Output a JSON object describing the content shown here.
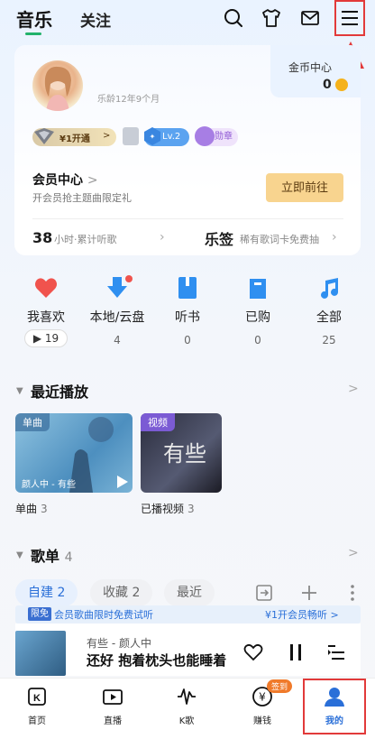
{
  "header": {
    "tabs": [
      {
        "label": "音乐",
        "active": true
      },
      {
        "label": "关注",
        "active": false
      }
    ],
    "icons": [
      "search-icon",
      "tshirt-icon",
      "mail-icon",
      "menu-icon"
    ]
  },
  "profile": {
    "level_age": "乐龄12年9个月",
    "coin_title": "金币中心",
    "coin_value": "0",
    "vip_label": "¥1开通",
    "vip_arrow": ">",
    "lv_label": "Lv.2",
    "medal_label": "勋章",
    "member_title": "会员中心",
    "member_chev": ">",
    "member_sub": "开会员抢主题曲限定礼",
    "goto_button": "立即前往",
    "hours_value": "38",
    "hours_label": "小时·累计听歌",
    "lyric_title": "乐签",
    "lyric_sub": "稀有歌词卡免费抽"
  },
  "quick_entries": [
    {
      "label": "我喜欢",
      "count": "▶ 19",
      "icon": "heart-icon"
    },
    {
      "label": "本地/云盘",
      "count": "4",
      "icon": "download-icon"
    },
    {
      "label": "听书",
      "count": "0",
      "icon": "book-icon"
    },
    {
      "label": "已购",
      "count": "0",
      "icon": "bag-icon"
    },
    {
      "label": "全部",
      "count": "25",
      "icon": "music-note-icon"
    }
  ],
  "recent": {
    "title": "最近播放",
    "caret": "▼",
    "chev": ">",
    "tiles": [
      {
        "tag": "单曲",
        "caption": "颜人中 - 有些",
        "label": "单曲",
        "count": "3"
      },
      {
        "tag": "视频",
        "caption": "",
        "video_text": "有些",
        "label": "已播视频",
        "count": "3"
      }
    ]
  },
  "playlists": {
    "title": "歌单",
    "count": "4",
    "tabs": [
      {
        "label": "自建 2",
        "active": true
      },
      {
        "label": "收藏 2",
        "active": false
      },
      {
        "label": "最近",
        "active": false
      }
    ]
  },
  "mini_player": {
    "promo_tag": "限免",
    "promo_text": "会员歌曲限时免费试听",
    "promo_right": "¥1开会员畅听 >",
    "song": "有些",
    "separator": "-",
    "artist": "颜人中",
    "lyric": "还好 抱着枕头也能睡着"
  },
  "bottom_nav": [
    {
      "label": "首页",
      "icon": "k-home-icon"
    },
    {
      "label": "直播",
      "icon": "live-tv-icon"
    },
    {
      "label": "K歌",
      "icon": "waveform-icon"
    },
    {
      "label": "赚钱",
      "icon": "yen-coin-icon",
      "badge": "签到"
    },
    {
      "label": "我的",
      "icon": "person-icon",
      "active": true
    }
  ],
  "colors": {
    "accent_green": "#22b26b",
    "accent_blue": "#2a6fd8",
    "highlight_red": "#e23a3a",
    "vip_gold": "#f8d48f"
  }
}
